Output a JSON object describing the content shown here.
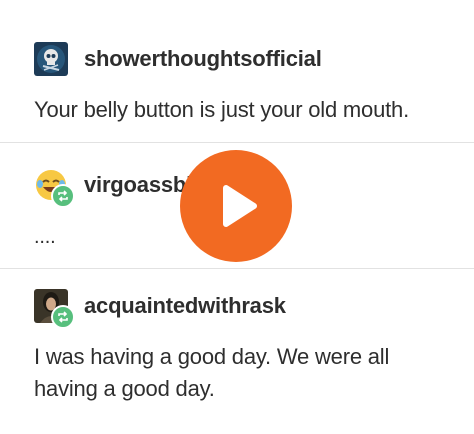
{
  "posts": [
    {
      "username": "showerthoughtsofficial",
      "avatar_icon": "skull-avatar-icon",
      "text": "Your belly button is just your old mouth."
    },
    {
      "username": "virgoassbitc",
      "avatar_icon": "laughing-emoji-avatar-icon",
      "reblog_icon": "reblog-icon",
      "text": "...."
    },
    {
      "username": "acquaintedwithrask",
      "avatar_icon": "portrait-avatar-icon",
      "reblog_icon": "reblog-icon",
      "text_line1": "I was having a good day. We were all",
      "text_line2": "having a good day."
    }
  ],
  "overlay": {
    "icon": "play-icon",
    "color": "#f26a22"
  },
  "colors": {
    "reblog_badge": "#57bf7d",
    "divider": "#e2e2e2",
    "text": "#2e2e2e"
  }
}
